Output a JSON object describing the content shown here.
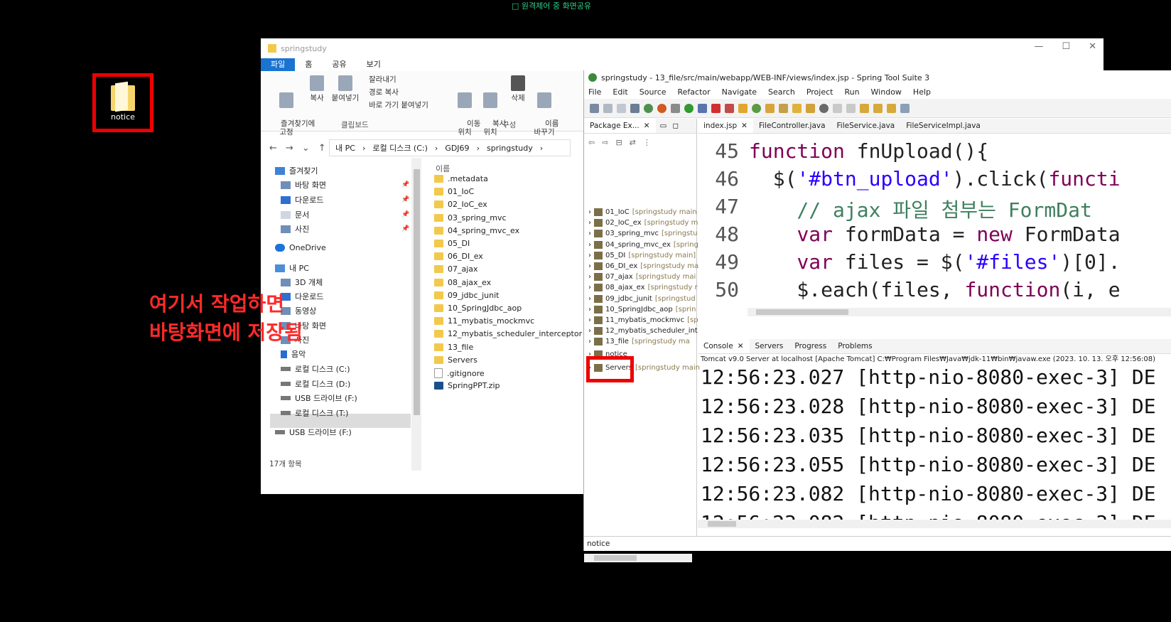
{
  "top_indicator": "□ 원격제어 중 화면공유",
  "desktop": {
    "icon_label": "notice",
    "annotation_line1": "여기서 작업하면",
    "annotation_line2": "바탕화면에 저장됨"
  },
  "explorer": {
    "title": "springstudy",
    "tabs": [
      "파일",
      "홈",
      "공유",
      "보기"
    ],
    "ribbon": {
      "pin": "즐겨찾기에\n고정",
      "copy": "복사",
      "paste": "붙여넣기",
      "cut": "잘라내기",
      "copy_path": "경로 복사",
      "paste_shortcut": "바로 가기 붙여넣기",
      "move_to": "이동\n위치",
      "copy_to": "복사\n위치",
      "delete": "삭제",
      "rename": "이름\n바꾸기",
      "group_clipboard": "클립보드",
      "group_organize": "구성"
    },
    "address": [
      "내 PC",
      "로컬 디스크 (C:)",
      "GDJ69",
      "springstudy"
    ],
    "nav": [
      "즐겨찾기",
      "바탕 화면",
      "다운로드",
      "문서",
      "사진",
      "OneDrive",
      "내 PC",
      "3D 개체",
      "다운로드",
      "동영상",
      "바탕 화면",
      "사진",
      "음악",
      "로컬 디스크 (C:)",
      "로컬 디스크 (D:)",
      "USB 드라이브 (F:)",
      "로컬 디스크 (T:)",
      "USB 드라이브 (F:)"
    ],
    "column_header": "이름",
    "files": [
      ".metadata",
      "01_IoC",
      "02_IoC_ex",
      "03_spring_mvc",
      "04_spring_mvc_ex",
      "05_DI",
      "06_DI_ex",
      "07_ajax",
      "08_ajax_ex",
      "09_jdbc_junit",
      "10_SpringJdbc_aop",
      "11_mybatis_mockmvc",
      "12_mybatis_scheduler_interceptor",
      "13_file",
      "Servers",
      ".gitignore",
      "SpringPPT.zip"
    ],
    "status": "17개 항목"
  },
  "eclipse": {
    "title": "springstudy - 13_file/src/main/webapp/WEB-INF/views/index.jsp - Spring Tool Suite 3",
    "menu": [
      "File",
      "Edit",
      "Source",
      "Refactor",
      "Navigate",
      "Search",
      "Project",
      "Run",
      "Window",
      "Help"
    ],
    "package_tab": "Package Ex...",
    "projects": [
      {
        "name": "01_IoC",
        "suffix": "[springstudy main"
      },
      {
        "name": "02_IoC_ex",
        "suffix": "[springstudy m"
      },
      {
        "name": "03_spring_mvc",
        "suffix": "[springstu"
      },
      {
        "name": "04_spring_mvc_ex",
        "suffix": "[spring"
      },
      {
        "name": "05_DI",
        "suffix": "[springstudy main]"
      },
      {
        "name": "06_DI_ex",
        "suffix": "[springstudy ma"
      },
      {
        "name": "07_ajax",
        "suffix": "[springstudy mai"
      },
      {
        "name": "08_ajax_ex",
        "suffix": "[springstudy r"
      },
      {
        "name": "09_jdbc_junit",
        "suffix": "[springstud"
      },
      {
        "name": "10_SpringJdbc_aop",
        "suffix": "[sprin"
      },
      {
        "name": "11_mybatis_mockmvc",
        "suffix": "[sp"
      },
      {
        "name": "12_mybatis_scheduler_int",
        "suffix": ""
      },
      {
        "name": "13_file",
        "suffix": "[springstudy ma"
      },
      {
        "name": "notice",
        "suffix": ""
      },
      {
        "name": "Servers",
        "suffix": "[springstudy main"
      }
    ],
    "editor_tabs": [
      "index.jsp",
      "FileController.java",
      "FileService.java",
      "FileServiceImpl.java"
    ],
    "code": [
      {
        "ln": "45",
        "parts": [
          [
            "kw",
            "function"
          ],
          [
            "",
            " fnUpload(){"
          ]
        ]
      },
      {
        "ln": "46",
        "parts": [
          [
            "",
            "  $("
          ],
          [
            "str",
            "'#btn_upload'"
          ],
          [
            "",
            ").click("
          ],
          [
            "kw",
            "functi"
          ]
        ]
      },
      {
        "ln": "47",
        "parts": [
          [
            "cmt",
            "    // ajax 파일 첨부는 FormDat"
          ]
        ]
      },
      {
        "ln": "48",
        "parts": [
          [
            "",
            "    "
          ],
          [
            "kw",
            "var"
          ],
          [
            "",
            " formData = "
          ],
          [
            "kw",
            "new"
          ],
          [
            "",
            " FormData"
          ]
        ]
      },
      {
        "ln": "49",
        "parts": [
          [
            "",
            "    "
          ],
          [
            "kw",
            "var"
          ],
          [
            "",
            " files = $("
          ],
          [
            "str",
            "'#files'"
          ],
          [
            "",
            ")[0]."
          ]
        ]
      },
      {
        "ln": "50",
        "parts": [
          [
            "",
            "    $.each(files, "
          ],
          [
            "kw",
            "function"
          ],
          [
            "",
            "(i, e"
          ]
        ]
      }
    ],
    "console_tabs": [
      "Console",
      "Servers",
      "Progress",
      "Problems"
    ],
    "console_info": "Tomcat v9.0 Server at localhost [Apache Tomcat] C:₩Program Files₩Java₩jdk-11₩bin₩javaw.exe  (2023. 10. 13. 오후 12:56:08)",
    "log": [
      "12:56:23.027 [http-nio-8080-exec-3] DE",
      "12:56:23.028 [http-nio-8080-exec-3] DE",
      "12:56:23.035 [http-nio-8080-exec-3] DE",
      "12:56:23.055 [http-nio-8080-exec-3] DE",
      "12:56:23.082 [http-nio-8080-exec-3] DE",
      "12:56:23.082 [http-nio-8080-exec-3] DE"
    ],
    "status": "notice"
  }
}
